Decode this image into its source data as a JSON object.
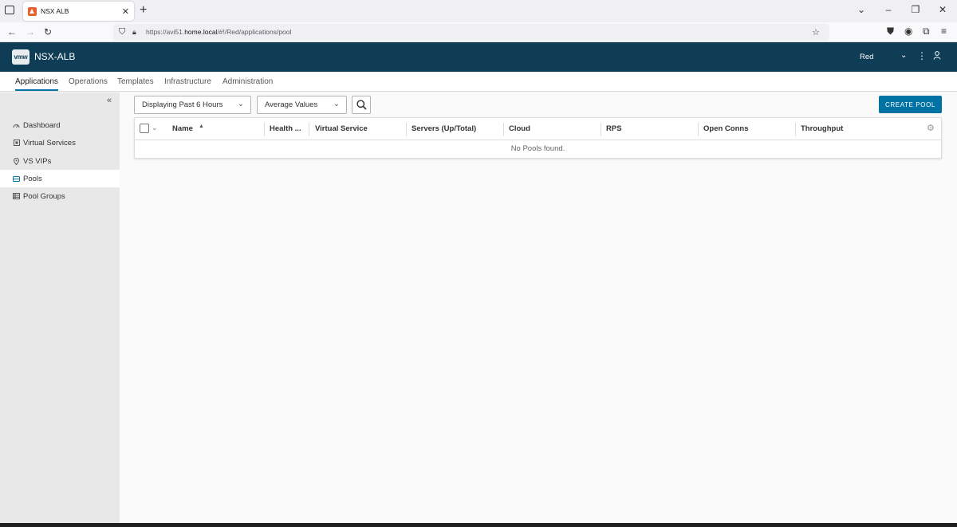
{
  "browser": {
    "tab_title": "NSX ALB",
    "url_prefix": "https://avi51.",
    "url_domain": "home.local",
    "url_path": "/#!/Red/applications/pool"
  },
  "app": {
    "logo_text": "vmw",
    "name": "NSX-ALB",
    "tenant": "Red"
  },
  "main_nav": {
    "items": [
      "Applications",
      "Operations",
      "Templates",
      "Infrastructure",
      "Administration"
    ],
    "active": "Applications"
  },
  "sidebar": {
    "items": [
      {
        "label": "Dashboard",
        "icon": "dashboard-icon"
      },
      {
        "label": "Virtual Services",
        "icon": "virtual-service-icon"
      },
      {
        "label": "VS VIPs",
        "icon": "location-pin-icon"
      },
      {
        "label": "Pools",
        "icon": "pool-icon",
        "active": true
      },
      {
        "label": "Pool Groups",
        "icon": "pool-groups-icon"
      }
    ]
  },
  "toolbar": {
    "time_range": "Displaying Past 6 Hours",
    "value_mode": "Average Values",
    "create_label": "CREATE POOL"
  },
  "grid": {
    "columns": [
      "Name",
      "Health ...",
      "Virtual Service",
      "Servers (Up/Total)",
      "Cloud",
      "RPS",
      "Open Conns",
      "Throughput"
    ],
    "empty_message": "No Pools found."
  }
}
